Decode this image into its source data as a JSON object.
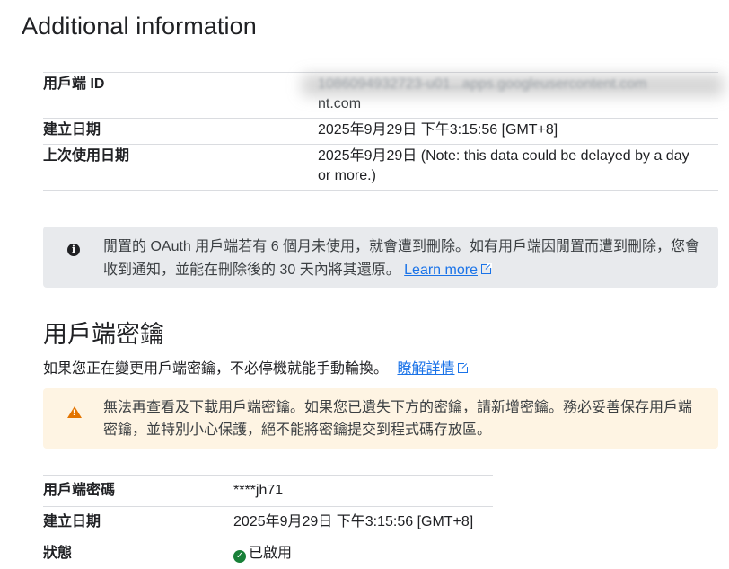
{
  "page": {
    "title": "Additional information"
  },
  "client_info": {
    "rows": [
      {
        "label": "用戶端 ID",
        "value": "1086094932723-u01...apps.googleusercontent.com",
        "value_tail": "nt.com",
        "blurred": true
      },
      {
        "label": "建立日期",
        "value": "2025年9月29日 下午3:15:56 [GMT+8]"
      },
      {
        "label": "上次使用日期",
        "value": "2025年9月29日 (Note: this data could be delayed by a day or more.)"
      }
    ]
  },
  "notice": {
    "icon": "info-icon",
    "text": "閒置的 OAuth 用戶端若有 6 個月未使用，就會遭到刪除。如有用戶端因閒置而遭到刪除，您會收到通知，並能在刪除後的 30 天內將其還原。",
    "link_label": "Learn more"
  },
  "secrets_section": {
    "title": "用戶端密鑰",
    "description": "如果您正在變更用戶端密鑰，不必停機就能手動輪換。",
    "learn_link": "瞭解詳情"
  },
  "warning": {
    "icon": "warning-icon",
    "text": "無法再查看及下載用戶端密鑰。如果您已遺失下方的密鑰，請新增密鑰。務必妥善保存用戶端密鑰，並特別小心保護，絕不能將密鑰提交到程式碼存放區。",
    "color": "#e37400"
  },
  "secret": {
    "rows": [
      {
        "label": "用戶端密碼",
        "value": "****jh71"
      },
      {
        "label": "建立日期",
        "value": "2025年9月29日 下午3:15:56 [GMT+8]"
      },
      {
        "label": "狀態",
        "value": "已啟用",
        "status_color": "#188038"
      }
    ]
  }
}
